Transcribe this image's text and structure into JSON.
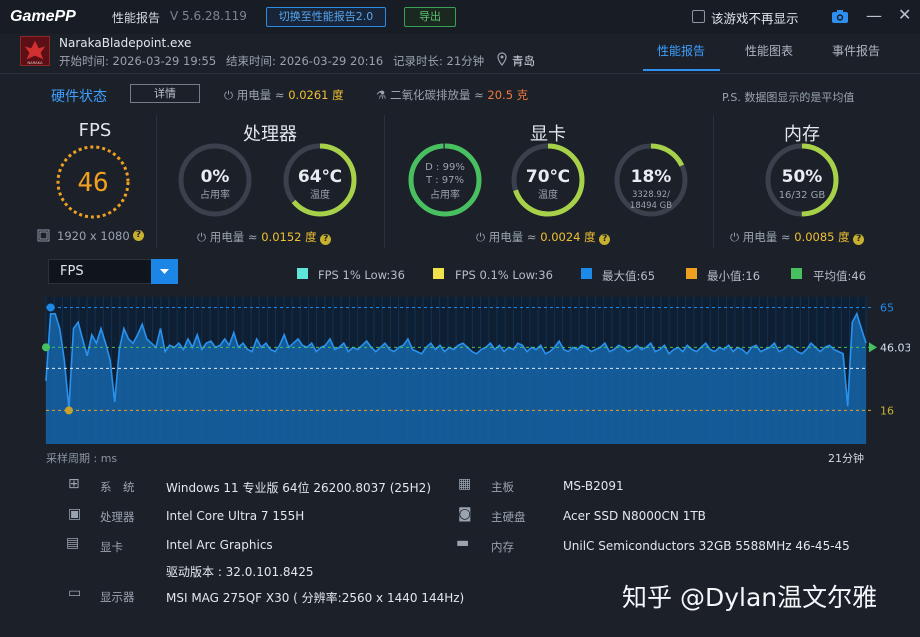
{
  "titlebar": {
    "logo": "GamePP",
    "title": "性能报告",
    "version": "V 5.6.28.119",
    "switch_label": "切换至性能报告2.0",
    "export_label": "导出",
    "no_show_label": "该游戏不再显示"
  },
  "game": {
    "name": "NarakaBladepoint.exe",
    "icon_text": "NARAKA",
    "start": "开始时间: 2026-03-29 19:55",
    "end": "结束时间: 2026-03-29 20:16",
    "duration": "记录时长: 21分钟",
    "location": "青岛"
  },
  "tabs": [
    "性能报告",
    "性能图表",
    "事件报告"
  ],
  "hw_status": {
    "title": "硬件状态",
    "detail_label": "详情",
    "power_prefix": "用电量 ≈ ",
    "power_value": "0.0261 度",
    "co2_prefix": "二氧化碳排放量 ≈ ",
    "co2_value": "20.5 克",
    "note": "P.S. 数据图显示的是平均值"
  },
  "sections": {
    "fps": {
      "title": "FPS",
      "value": "46",
      "resolution": "1920 x 1080"
    },
    "cpu": {
      "title": "处理器",
      "usage": "0%",
      "usage_label": "占用率",
      "usage_fraction": 0.0,
      "temp": "64℃",
      "temp_label": "温度",
      "temp_fraction": 0.64,
      "power_prefix": "用电量 ≈ ",
      "power_value": "0.0152 度"
    },
    "gpu": {
      "title": "显卡",
      "d_usage": "D : 99%",
      "t_usage": "T : 97%",
      "usage_label": "占用率",
      "usage_fraction": 0.99,
      "temp": "70℃",
      "temp_label": "温度",
      "temp_fraction": 0.7,
      "vram": "18%",
      "vram_detail_1": "3328.92/",
      "vram_detail_2": "18494 GB",
      "vram_fraction": 0.18,
      "power_prefix": "用电量 ≈ ",
      "power_value": "0.0024 度"
    },
    "mem": {
      "title": "内存",
      "usage": "50%",
      "detail": "16/32 GB",
      "usage_fraction": 0.5,
      "power_prefix": "用电量 ≈ ",
      "power_value": "0.0085 度"
    }
  },
  "chart_controls": {
    "select_label": "FPS",
    "legend": [
      {
        "label": "FPS 1% Low:36",
        "color": "#5ee6d8"
      },
      {
        "label": "FPS 0.1% Low:36",
        "color": "#f2e24a"
      },
      {
        "label": "最大值:65",
        "color": "#1e8ae8"
      },
      {
        "label": "最小值:16",
        "color": "#f0a020"
      },
      {
        "label": "平均值:46",
        "color": "#48c060"
      }
    ]
  },
  "chart_data": {
    "type": "area",
    "max": 65,
    "avg": 46.03,
    "min": 16,
    "max_label": "65",
    "avg_label": "46.03",
    "min_label": "16",
    "ylim": [
      0,
      70
    ],
    "x_start_label": "采样周期 : ms",
    "x_end_label": "21分钟",
    "values": [
      30,
      62,
      62,
      55,
      40,
      17,
      55,
      58,
      50,
      42,
      52,
      48,
      55,
      48,
      40,
      20,
      45,
      55,
      50,
      48,
      52,
      57,
      50,
      48,
      46,
      55,
      44,
      47,
      46,
      48,
      45,
      50,
      46,
      52,
      45,
      48,
      49,
      46,
      47,
      50,
      47,
      53,
      46,
      48,
      45,
      44,
      50,
      46,
      48,
      45,
      44,
      47,
      52,
      46,
      48,
      50,
      47,
      46,
      48,
      44,
      46,
      47,
      50,
      45,
      46,
      48,
      44,
      46,
      45,
      47,
      49,
      46,
      44,
      46,
      48,
      45,
      44,
      46,
      47,
      50,
      45,
      44,
      43,
      46,
      48,
      45,
      47,
      44,
      46,
      45,
      47,
      48,
      46,
      44,
      43,
      45,
      46,
      48,
      45,
      47,
      44,
      46,
      45,
      48,
      47,
      44,
      46,
      45,
      47,
      43,
      44,
      46,
      49,
      45,
      44,
      46,
      45,
      47,
      46,
      44,
      45,
      46,
      48,
      44,
      45,
      47,
      46,
      44,
      45,
      47,
      45,
      46,
      48,
      44,
      45,
      47,
      43,
      45,
      46,
      44,
      47,
      45,
      44,
      46,
      48,
      45,
      44,
      46,
      45,
      47,
      44,
      46,
      45,
      43,
      46,
      47,
      44,
      45,
      46,
      48,
      44,
      45,
      47,
      46,
      44,
      43,
      45,
      48,
      46,
      44,
      46,
      47,
      45,
      44,
      43,
      18,
      58,
      62,
      55,
      48
    ]
  },
  "info": [
    {
      "label": "系　统",
      "value": "Windows 11 专业版 64位 26200.8037 (25H2)",
      "icon": "windows-icon"
    },
    {
      "label": "处理器",
      "value": "Intel Core Ultra 7 155H",
      "icon": "cpu-icon"
    },
    {
      "label": "显卡",
      "value": "Intel Arc Graphics",
      "value2": "驱动版本 : 32.0.101.8425",
      "icon": "gpu-icon"
    },
    {
      "label": "显示器",
      "value": "MSI MAG 275QF X30 ( 分辨率:2560 x 1440 144Hz)",
      "icon": "monitor-icon"
    },
    {
      "label": "主板",
      "value": "MS-B2091",
      "icon": "motherboard-icon"
    },
    {
      "label": "主硬盘",
      "value": "Acer SSD N8000CN 1TB",
      "icon": "disk-icon"
    },
    {
      "label": "内存",
      "value": "UnilC Semiconductors 32GB 5588MHz 46-45-45-9",
      "icon": "ram-icon"
    }
  ],
  "watermark": "知乎 @Dylan温文尔雅"
}
